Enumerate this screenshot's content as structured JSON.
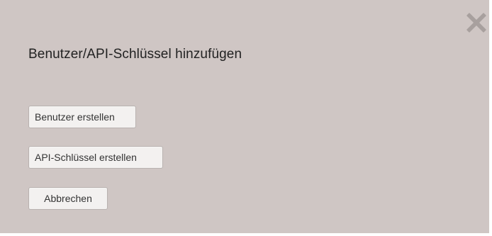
{
  "dialog": {
    "title": "Benutzer/API-Schlüssel hinzufügen",
    "close_icon": "close-x-icon",
    "buttons": {
      "create_user": "Benutzer erstellen",
      "create_api_key": "API-Schlüssel erstellen",
      "cancel": "Abbrechen"
    }
  },
  "colors": {
    "dialog_background": "#cfc6c4",
    "button_background": "#f3f1f0",
    "close_icon": "#a8a09e"
  }
}
